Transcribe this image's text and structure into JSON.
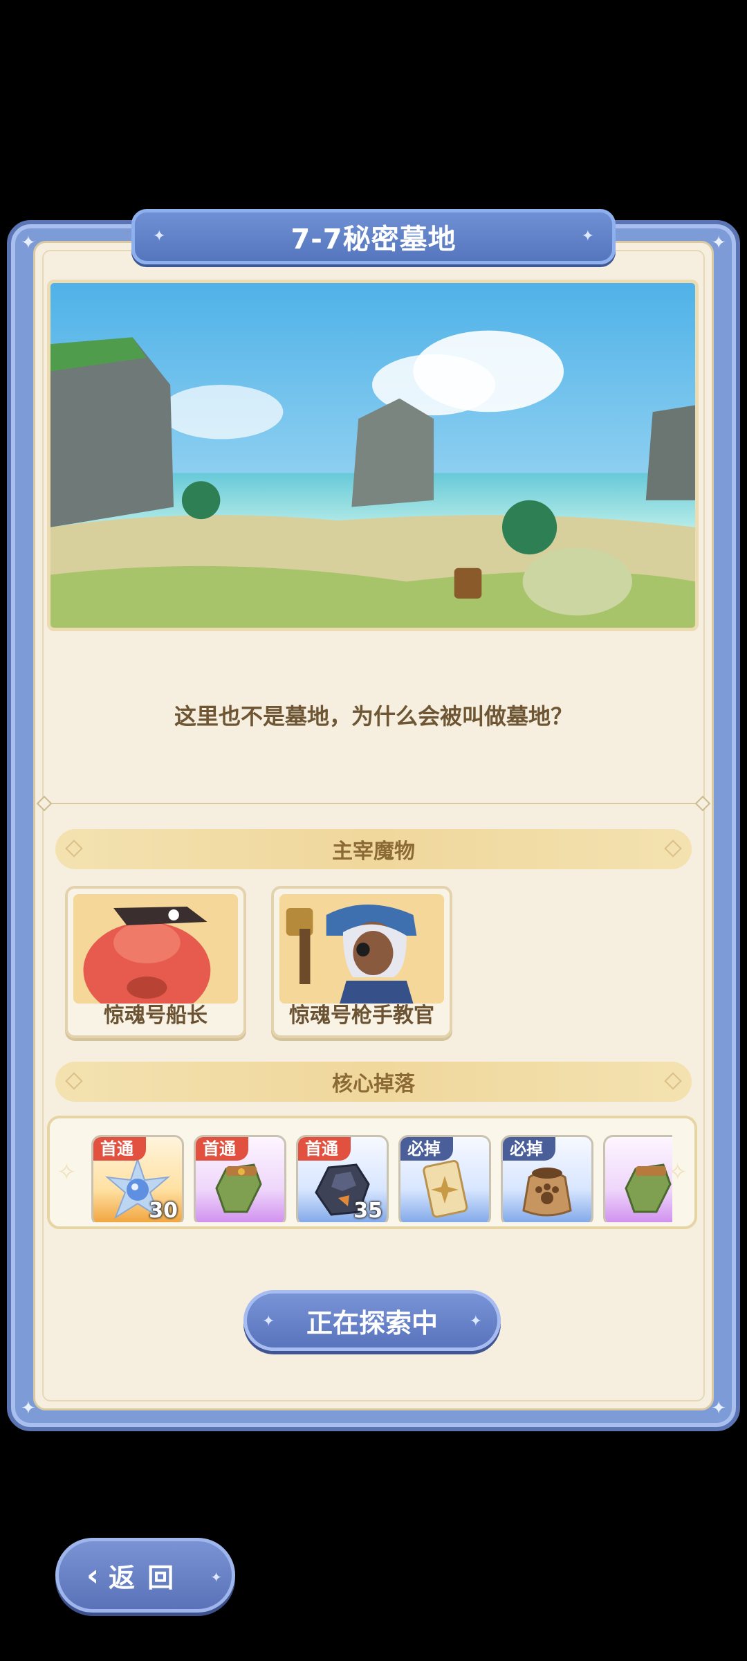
{
  "level": {
    "title": "7-7秘密墓地"
  },
  "description": "这里也不是墓地，为什么会被叫做墓地？",
  "monsters_section": {
    "header": "主宰魔物",
    "items": [
      {
        "name": "惊魂号船长"
      },
      {
        "name": "惊魂号枪手教官"
      }
    ]
  },
  "drops_section": {
    "header": "核心掉落",
    "items": [
      {
        "tag": "首通",
        "qty": "30",
        "icon": "crystal-star-icon",
        "rarity": "orange"
      },
      {
        "tag": "首通",
        "qty": "",
        "icon": "gauntlet-icon",
        "rarity": "purple"
      },
      {
        "tag": "首通",
        "qty": "35",
        "icon": "ore-icon",
        "rarity": "blue"
      },
      {
        "tag": "必掉",
        "qty": "",
        "icon": "card-icon",
        "rarity": "blue"
      },
      {
        "tag": "必掉",
        "qty": "",
        "icon": "pet-food-bag-icon",
        "rarity": "blue"
      },
      {
        "tag": "",
        "qty": "",
        "icon": "gauntlet-icon",
        "rarity": "purple"
      }
    ]
  },
  "actions": {
    "explore_label": "正在探索中",
    "back_label": "返回"
  },
  "colors": {
    "panel_blue": "#7d9bd6",
    "panel_cream": "#f6efdf",
    "tag_red": "#e2503f",
    "tag_navy": "#4a5e99"
  }
}
